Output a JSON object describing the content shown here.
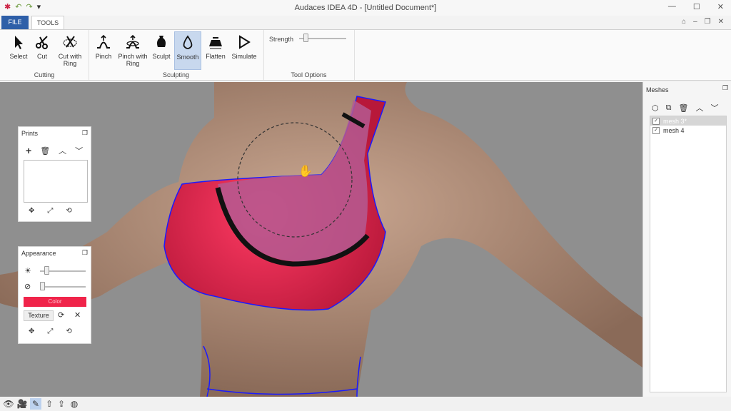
{
  "app": {
    "title": "Audaces IDEA 4D - [Untitled Document*]"
  },
  "tabs": {
    "file": "FILE",
    "tools": "TOOLS"
  },
  "ribbon": {
    "cutting": {
      "label": "Cutting",
      "select": "Select",
      "cut": "Cut",
      "cut_with_ring": "Cut with Ring"
    },
    "sculpting": {
      "label": "Sculpting",
      "pinch": "Pinch",
      "pinch_with_ring": "Pinch with Ring",
      "sculpt": "Sculpt",
      "smooth": "Smooth",
      "flatten": "Flatten",
      "simulate": "Simulate"
    },
    "tool_options": {
      "label": "Tool Options",
      "strength_label": "Strength",
      "strength_value": 0.1
    }
  },
  "prints_panel": {
    "title": "Prints"
  },
  "appearance_panel": {
    "title": "Appearance",
    "color_label": "Color",
    "color_swatch": "#f0244a",
    "texture_label": "Texture",
    "brightness_value": 0.1,
    "visibility_value": 0.0
  },
  "meshes_panel": {
    "title": "Meshes",
    "items": [
      {
        "label": "mesh 3*",
        "checked": true,
        "selected": true
      },
      {
        "label": "mesh 4",
        "checked": true,
        "selected": false
      }
    ]
  }
}
